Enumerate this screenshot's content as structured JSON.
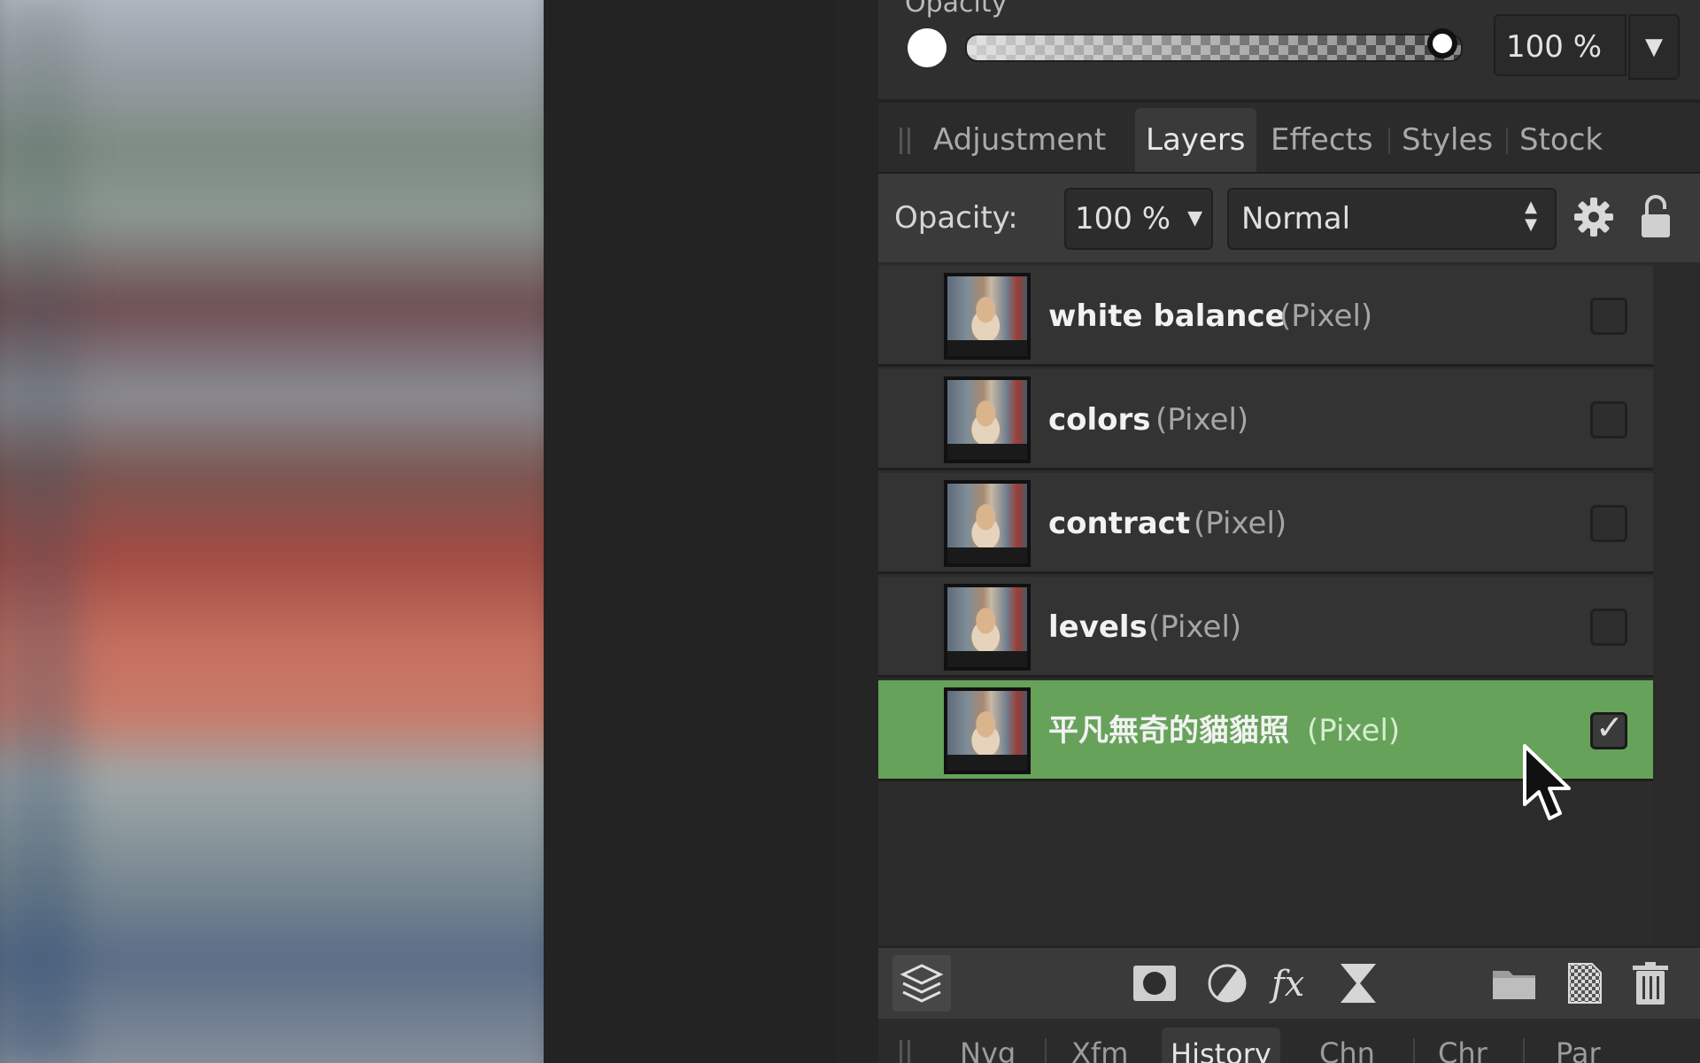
{
  "top_strip": {
    "title": "Opacity",
    "opacity_value": "100 %"
  },
  "tabs": [
    {
      "label": "Adjustment"
    },
    {
      "label": "Layers"
    },
    {
      "label": "Effects"
    },
    {
      "label": "Styles"
    },
    {
      "label": "Stock"
    }
  ],
  "layer_controls": {
    "opacity_label": "Opacity:",
    "opacity_value": "100 %",
    "blend_mode": "Normal"
  },
  "layers": [
    {
      "name": "white balance",
      "type": "(Pixel)",
      "visible_checked": false,
      "selected": false
    },
    {
      "name": "colors",
      "type": "(Pixel)",
      "visible_checked": false,
      "selected": false
    },
    {
      "name": "contract",
      "type": "(Pixel)",
      "visible_checked": false,
      "selected": false
    },
    {
      "name": "levels",
      "type": "(Pixel)",
      "visible_checked": false,
      "selected": false
    },
    {
      "name": "平凡無奇的貓貓照",
      "type": "(Pixel)",
      "visible_checked": true,
      "selected": true
    }
  ],
  "bottom_tabs": [
    {
      "label": "Nvg"
    },
    {
      "label": "Xfm"
    },
    {
      "label": "History"
    },
    {
      "label": "Chn"
    },
    {
      "label": "Chr"
    },
    {
      "label": "Par"
    }
  ],
  "colors": {
    "selected_row": "#66a25a",
    "panel_bg": "#2b2b2b"
  }
}
